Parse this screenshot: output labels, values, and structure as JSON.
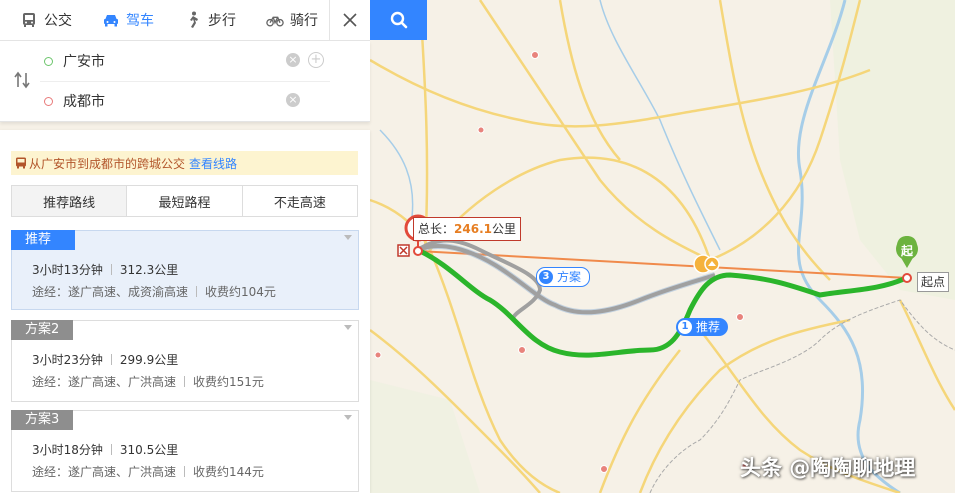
{
  "modes": {
    "bus": "公交",
    "drive": "驾车",
    "walk": "步行",
    "bike": "骑行"
  },
  "route_input": {
    "start_value": "广安市",
    "end_value": "成都市"
  },
  "bus_tip": {
    "text": "从广安市到成都市的跨城公交",
    "link": "查看线路"
  },
  "sort_tabs": [
    "推荐路线",
    "最短路程",
    "不走高速"
  ],
  "plans": [
    {
      "tag": "推荐",
      "duration": "3小时13分钟",
      "distance": "312.3公里",
      "via": "途经：遂广高速、成资渝高速",
      "toll": "收费约104元"
    },
    {
      "tag": "方案2",
      "duration": "3小时23分钟",
      "distance": "299.9公里",
      "via": "途经：遂广高速、广洪高速",
      "toll": "收费约151元"
    },
    {
      "tag": "方案3",
      "duration": "3小时18分钟",
      "distance": "310.5公里",
      "via": "途经：遂广高速、广洪高速",
      "toll": "收费约144元"
    }
  ],
  "map": {
    "total_prefix": "总长：",
    "total_km": "246.1",
    "total_unit": "公里",
    "bubble_recommended_num": "1",
    "bubble_recommended_label": "推荐",
    "bubble_plan3_num": "3",
    "bubble_plan3_label": "方案",
    "start_marker": "起",
    "start_label": "起点",
    "watermark": "头条 @陶陶聊地理"
  },
  "colors": {
    "accent": "#3385ff",
    "route_recommended": "#2bb52b",
    "route_alt": "#a0a0a0",
    "measure_line": "#f08a4b",
    "start_pin": "#6cb33f",
    "end_pin": "#e24a3b"
  }
}
